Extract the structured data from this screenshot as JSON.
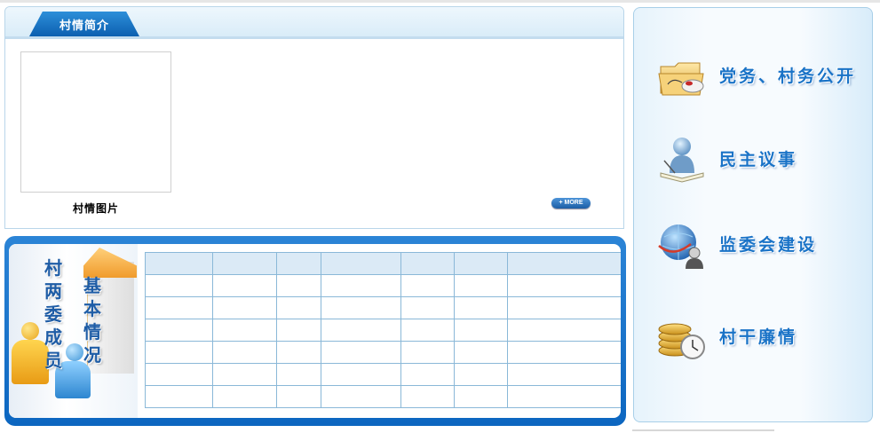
{
  "intro": {
    "tab_label": "村情简介",
    "photo_caption": "村情图片",
    "more_label": "+ MORE"
  },
  "committee": {
    "title_col1": [
      "村",
      "两",
      "委",
      "成",
      "员"
    ],
    "title_col2": [
      "基",
      "本",
      "情",
      "况"
    ],
    "table": {
      "columns": 7,
      "rows": 7
    }
  },
  "nav": {
    "items": [
      {
        "label": "党务、村务公开",
        "icon": "folder-mouse-icon"
      },
      {
        "label": "民主议事",
        "icon": "person-reading-icon"
      },
      {
        "label": "监委会建设",
        "icon": "globe-user-icon"
      },
      {
        "label": "村干廉情",
        "icon": "coins-clock-icon"
      }
    ]
  },
  "colors": {
    "accent_blue": "#1a73c7",
    "header_tab": "#0c5fb0",
    "panel_border": "#a8cfe8"
  }
}
